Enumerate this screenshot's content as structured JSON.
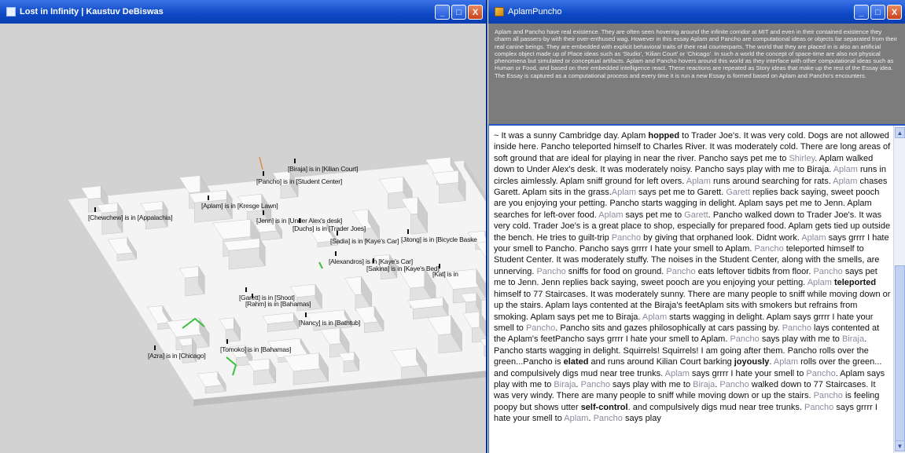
{
  "left_window": {
    "title": "Lost in Infinity | Kaustuv DeBiswas",
    "controls": {
      "minimize": "_",
      "maximize": "□",
      "close": "X"
    },
    "labels": [
      "[Biraja] is in [Kilian Court]",
      "[Pancho] is in [Student Center]",
      "[Aplam] is in [Kresge Lawn]",
      "[Chewchew] is in [Appalachia]",
      "[Jenn] is in [Under Alex's desk]",
      "[Duchs] is in [Trader Joes]",
      "[Sadia] is in [Kaye's Car]",
      "[Jitong] is in [Bicycle Baske",
      "[Alexandros] is in [Kaye's Car]",
      "[Sakina] is in [Kaye's Bed]",
      "[Kat] is in",
      "[Garett] is in [Shoot]",
      "[Rahm] is in [Bahamas]",
      "[Nancy] is in [Bathtub]",
      "[Tomoko] is in [Bahamas]",
      "[Azra] is in [Chicago]"
    ]
  },
  "right_window": {
    "title": "AplamPuncho",
    "controls": {
      "minimize": "_",
      "maximize": "□",
      "close": "X"
    },
    "description": "Aplam and Pancho have real existence. They are often seen hovering around the infinite corridor at MIT and even in their contained existence they charm all passers-by with their over-enthused wag. However in this essay Aplam and Pancho are computational ideas or objects far separated from their real canine beings. They are embedded with explicit behavioral traits of their real counterparts. The world that they are placed in is also an artificial complex object made up of Place ideas such as 'Studio', 'Kilian Court' or 'Chicago'. In such a world the concept of space-time are also not physical phenomena but simulated or conceptual artifacts. Aplam and Pancho hovers around this world as they interface with other computational ideas such as Human or Food, and based on their embedded intelligence react. These reactions are repeated as Story ideas that make up the rest of the Essay idea. The Essay is captured as a computational process and every time it is run a new Essay is formed based on Aplam and Pancho's encounters.",
    "essay_runs": [
      [
        "~ It was a sunny Cambridge day. Aplam ",
        "b:hopped",
        " to Trader Joe's. It was very cold. Dogs are not allowed inside here. Pancho teleported himself to Charles River. It was moderately cold. There are long areas of soft ground that are ideal for playing in near the river. Pancho says pet me to ",
        "n:Shirley",
        ". Aplam walked down to Under Alex's desk. It was moderately noisy. Pancho says play with me to Biraja. ",
        "n:Aplam",
        " runs in circles aimlessly. Aplam sniff ground for left overs. ",
        "n:Aplam",
        " runs around searching for rats. ",
        "n:Aplam",
        " chases Garett. Aplam sits in the grass.",
        "n:Aplam",
        " says pet me to Garett. ",
        "n:Garett",
        " replies back saying, sweet pooch are you enjoying your petting. Pancho starts wagging in delight. Aplam says pet me to Jenn. Aplam searches for left-over food. ",
        "n:Aplam",
        " says pet me to ",
        "n:Garett",
        ". Pancho walked down to Trader Joe's. It was very cold. Trader Joe's is a great place to shop, especially for prepared food. Aplam gets tied up outside the bench. He tries to guilt-trip ",
        "n:Pancho",
        " by giving that orphaned look. Didnt work. ",
        "n:Aplam",
        " says grrrr I hate your smell to Pancho. Pancho says grrrr I hate your smell to Aplam. ",
        "n:Pancho",
        " teleported himself to Student Center. It was moderately stuffy. The noises in the Student Center, along with the smells, are unnerving. ",
        "n:Pancho",
        " sniffs for food on ground. ",
        "n:Pancho",
        " eats leftover tidbits from floor. ",
        "n:Pancho",
        " says pet me to Jenn. Jenn replies back saying, sweet pooch are you enjoying your petting. ",
        "n:Aplam",
        " ",
        "b:teleported",
        " himself to 77 Staircases. It was moderately sunny. There are many people to sniff while moving down or up the stairs. Aplam lays contented at the Biraja's feetAplam sits with smokers but refrains from smoking. Aplam says pet me to Biraja. ",
        "n:Aplam",
        " starts wagging in delight. Aplam says grrrr I hate your smell to ",
        "n:Pancho",
        ". Pancho sits and gazes philosophically at cars passing by. ",
        "n:Pancho",
        " lays contented at the Aplam's feetPancho says grrrr I hate your smell to Aplam. ",
        "n:Pancho",
        " says play with me to ",
        "n:Biraja",
        ". Pancho starts wagging in delight. Squirrels! Squirrels! I am going after them. Pancho rolls over the green...Pancho is ",
        "b:elated",
        " and runs around Kilian Court barking ",
        "b:joyously",
        ". ",
        "n:Aplam",
        " rolls over the green... and compulsively digs mud near tree trunks. ",
        "n:Aplam",
        " says grrrr I hate your smell to ",
        "n:Pancho",
        ". Aplam says play with me to ",
        "n:Biraja",
        ". ",
        "n:Pancho",
        " says play with me to ",
        "n:Biraja",
        ". ",
        "n:Pancho",
        " walked down to 77 Staircases. It was very windy. There are many people to sniff while moving down or up the stairs. ",
        "n:Pancho",
        " is feeling poopy but shows utter ",
        "b:self-control",
        ". and compulsively digs mud near tree trunks. ",
        "n:Pancho",
        " says grrrr I hate your smell to ",
        "n:Aplam",
        ". ",
        "n:Pancho",
        " says play"
      ]
    ],
    "scrollbar": {
      "up": "▲",
      "down": "▼"
    }
  },
  "colors": {
    "titlebar": "#0c48c4",
    "viewport_bg": "#d2d2d2",
    "info_bg": "#7c7c7c",
    "name_gray": "#8a8a9e"
  }
}
